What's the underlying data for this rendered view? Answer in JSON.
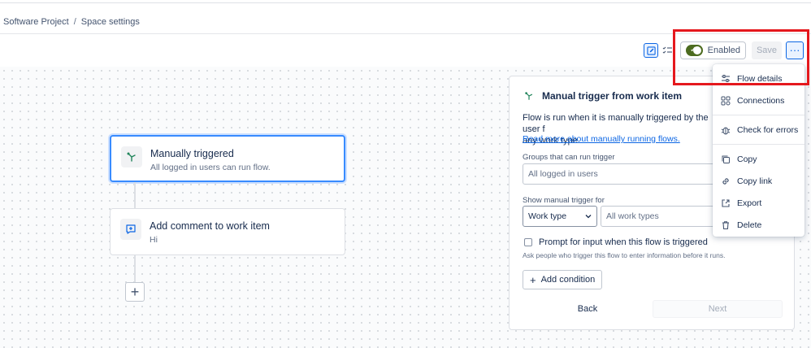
{
  "breadcrumb": {
    "project": "Software Project",
    "separator": "/",
    "page": "Space settings"
  },
  "toolbar": {
    "toggle_label": "Enabled",
    "toggle_on": true,
    "save_label": "Save",
    "more_label": "···"
  },
  "colors": {
    "accent": "#0c66e4",
    "toggle_on": "#4c6b1f",
    "highlight": "#e5181d"
  },
  "flow": {
    "trigger": {
      "title": "Manually triggered",
      "subtitle": "All logged in users can run flow."
    },
    "action": {
      "title": "Add comment to work item",
      "subtitle": "Hi"
    },
    "add_label": "+"
  },
  "panel": {
    "title": "Manual trigger from work item",
    "desc_line1": "Flow is run when it is manually triggered by the user f",
    "desc_line2": "any work type.",
    "link": "Read more about manually running flows.",
    "groups_label": "Groups that can run trigger",
    "groups_placeholder": "All logged in users",
    "show_label": "Show manual trigger for",
    "work_type_select": "Work type",
    "work_types_placeholder": "All work types",
    "prompt_label": "Prompt for input when this flow is triggered",
    "prompt_hint": "Ask people who trigger this flow to enter information before it runs.",
    "add_condition": "Add condition",
    "back": "Back",
    "next": "Next"
  },
  "menu": {
    "items": [
      {
        "label": "Flow details",
        "icon": "sliders-icon"
      },
      {
        "label": "Connections",
        "icon": "connections-icon"
      },
      {
        "label": "Check for errors",
        "icon": "bug-icon"
      },
      {
        "label": "Copy",
        "icon": "copy-icon"
      },
      {
        "label": "Copy link",
        "icon": "link-icon"
      },
      {
        "label": "Export",
        "icon": "export-icon"
      },
      {
        "label": "Delete",
        "icon": "trash-icon"
      }
    ]
  }
}
